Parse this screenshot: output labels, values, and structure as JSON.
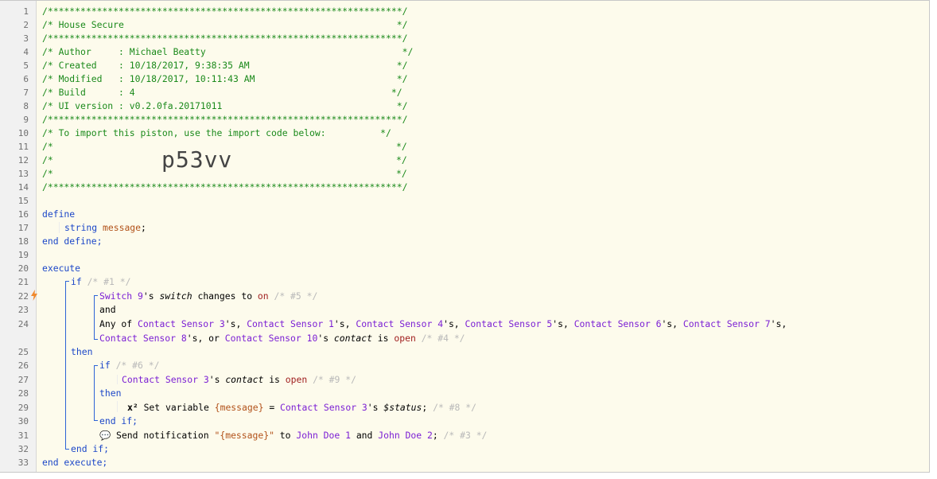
{
  "line_numbers": [
    "1",
    "2",
    "3",
    "4",
    "5",
    "6",
    "7",
    "8",
    "9",
    "10",
    "11",
    "12",
    "13",
    "14",
    "15",
    "16",
    "17",
    "18",
    "19",
    "20",
    "21",
    "22",
    "23",
    "24",
    "",
    "25",
    "26",
    "27",
    "28",
    "29",
    "30",
    "31",
    "32",
    "33"
  ],
  "header": {
    "border": "/*****************************************************************/",
    "title": "/* House Secure                                                  */",
    "author": "/* Author     : Michael Beatty                                    */",
    "created": "/* Created    : 10/18/2017, 9:38:35 AM                           */",
    "modified": "/* Modified   : 10/18/2017, 10:11:43 AM                          */",
    "build": "/* Build      : 4                                               */",
    "ui_version": "/* UI version : v0.2.0fa.20171011                                */",
    "import_note": "/* To import this piston, use the import code below:          */",
    "blank_left": "/*",
    "blank_right": "*/",
    "import_code": "p53vv"
  },
  "code": {
    "define": "define",
    "string_kw": "string",
    "message_var": "message",
    "semicolon": ";",
    "end_define": "end define;",
    "execute": "execute",
    "if": "if",
    "c1": "/* #1 */",
    "switch_dev": "Switch 9",
    "apos_s": "'s",
    "switch_attr": "switch",
    "changes_to": "changes to",
    "on_val": "on",
    "c5": "/* #5 */",
    "and": "and",
    "any_of": "Any of",
    "cs3": "Contact Sensor 3",
    "cs1": "Contact Sensor 1",
    "cs4": "Contact Sensor 4",
    "cs5": "Contact Sensor 5",
    "cs6": "Contact Sensor 6",
    "cs7": "Contact Sensor 7",
    "cs8": "Contact Sensor 8",
    "cs10": "Contact Sensor 10",
    "sep": "'s,",
    "or_sep": "'s, or",
    "contact_attr": "contact",
    "is": "is",
    "open_val": "open",
    "c4": "/* #4 */",
    "then": "then",
    "c6": "/* #6 */",
    "c9": "/* #9 */",
    "x2": "x²",
    "set_variable": "Set variable",
    "message_ref": "{message}",
    "equals": "=",
    "status_attr": "$status",
    "c8": "/* #8 */",
    "end_if": "end if;",
    "chat_icon": "💬",
    "send_notification": "Send notification",
    "quote_msg": "\"{message}\"",
    "to": "to",
    "john1": "John Doe 1",
    "john2": "John Doe 2",
    "c3": "/* #3 */",
    "end_execute": "end execute;"
  },
  "colors": {
    "comment": "#1b8a1b",
    "keyword": "#1c47c8",
    "variable": "#b2521a",
    "device": "#7b1fd4",
    "value": "#a01f1f",
    "muted_comment": "#b9b9b9",
    "trigger_icon": "#f08a2e"
  },
  "icons": {
    "trigger": "lightning-icon",
    "notification": "speech-bubble-icon",
    "variable": "x-squared-icon"
  }
}
